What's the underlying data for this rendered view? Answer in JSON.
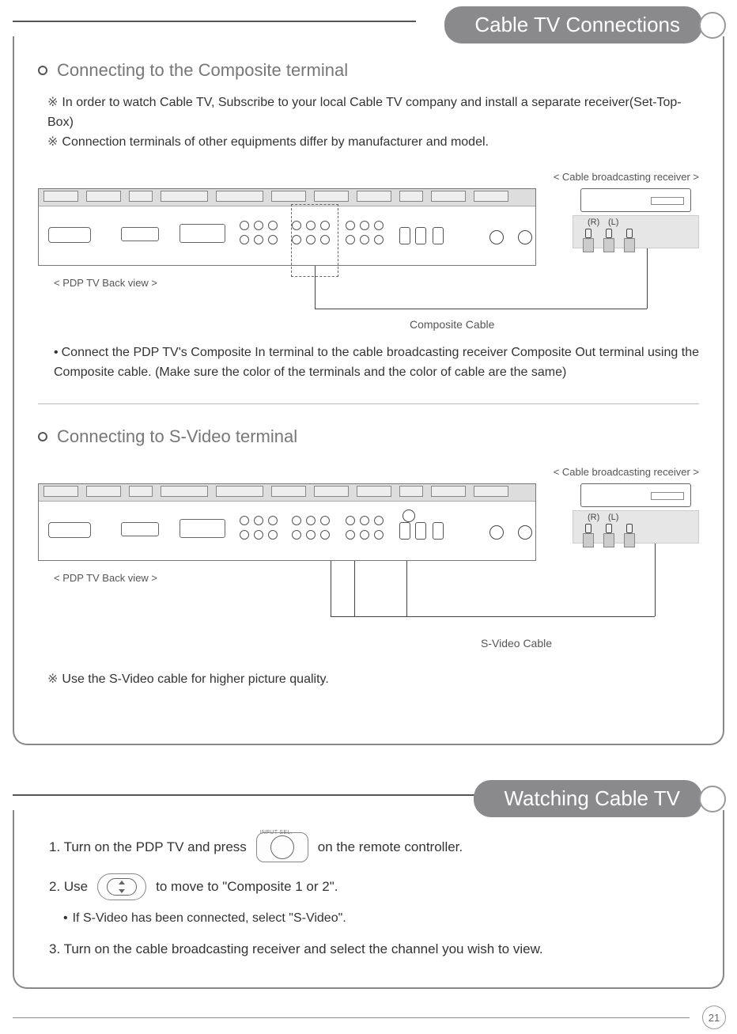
{
  "header1": {
    "title": "Cable TV Connections"
  },
  "section1": {
    "title": "Connecting to the Composite terminal",
    "notes": [
      "In order to watch Cable TV, Subscribe to your local Cable TV company and install a separate receiver(Set-Top-Box)",
      "Connection terminals of other equipments differ by manufacturer and model."
    ],
    "recv_label": "< Cable broadcasting receiver >",
    "bp_caption": "< PDP TV Back view >",
    "recv_R": "(R)",
    "recv_L": "(L)",
    "cable_label": "Composite Cable",
    "body": "Connect the PDP TV's Composite In terminal to the cable broadcasting receiver Composite Out terminal using the Composite cable. (Make sure the color of the terminals and the color of cable are the same)"
  },
  "section2": {
    "title": "Connecting to S-Video terminal",
    "recv_label": "< Cable broadcasting receiver >",
    "bp_caption": "< PDP TV Back view >",
    "recv_R": "(R)",
    "recv_L": "(L)",
    "cable_label": "S-Video Cable",
    "note": "Use the S-Video cable for higher picture quality."
  },
  "header2": {
    "title": "Watching Cable TV"
  },
  "steps": {
    "s1a": "1. Turn on the PDP TV and press",
    "s1b": "on the remote controller.",
    "input_btn_label": "INPUT SEL.",
    "s2a": "2. Use",
    "s2b": "to move to \"Composite 1 or 2\".",
    "sub": "If S-Video has been connected, select \"S-Video\".",
    "s3": "3. Turn on the cable broadcasting receiver and select the channel you wish to view."
  },
  "page_number": "21",
  "glyphs": {
    "note": "※",
    "dot": "•"
  }
}
